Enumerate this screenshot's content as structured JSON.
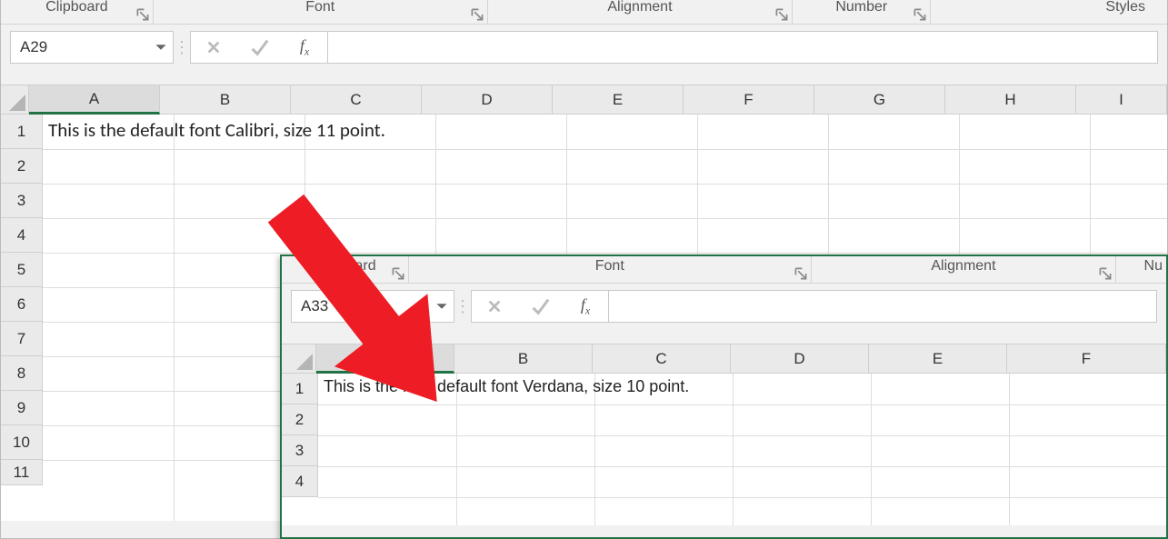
{
  "window1": {
    "ribbon": {
      "groups": [
        "Clipboard",
        "Font",
        "Alignment",
        "Number",
        "Styles"
      ]
    },
    "namebox": "A29",
    "fx_label": "fx",
    "columns": [
      "A",
      "B",
      "C",
      "D",
      "E",
      "F",
      "G",
      "H",
      "I"
    ],
    "rows": [
      "1",
      "2",
      "3",
      "4",
      "5",
      "6",
      "7",
      "8",
      "9",
      "10",
      "11"
    ],
    "cell_a1": "This is the default font Calibri, size 11 point."
  },
  "window2": {
    "ribbon": {
      "groups": [
        "Clipboard",
        "Font",
        "Alignment",
        "Nu"
      ]
    },
    "namebox": "A33",
    "fx_label": "fx",
    "columns": [
      "A",
      "B",
      "C",
      "D",
      "E",
      "F"
    ],
    "rows": [
      "1",
      "2",
      "3",
      "4"
    ],
    "cell_a1": "This is the new default font Verdana, size 10 point."
  }
}
